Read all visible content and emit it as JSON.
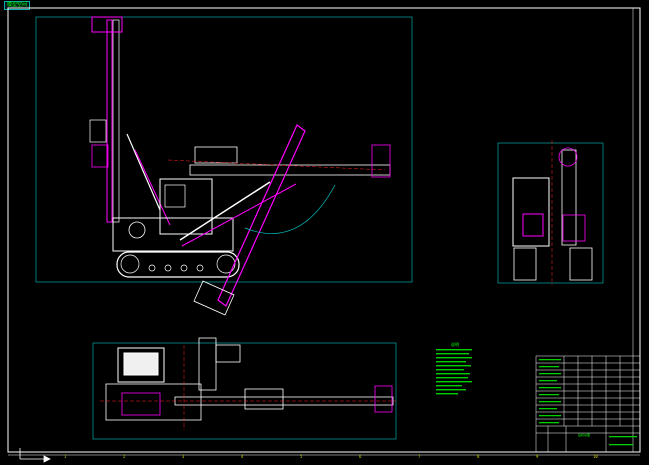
{
  "app": {
    "tab_label": "模型空间"
  },
  "notes": {
    "title": "说明"
  },
  "title_block": {
    "drawing_title": "钻机总图"
  },
  "ruler": {
    "marks": [
      "1",
      "2",
      "3",
      "4",
      "5",
      "6",
      "7",
      "8",
      "9",
      "10"
    ]
  },
  "colors": {
    "background": "#000000",
    "frame": "#ffffff",
    "cyan": "#00c8c8",
    "magenta": "#ff00ff",
    "green": "#00ff00",
    "red": "#ff2020",
    "yellow": "#e0e000"
  }
}
